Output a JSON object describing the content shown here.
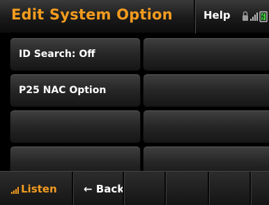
{
  "header": {
    "title": "Edit System Option",
    "help_label": "Help",
    "status_icons": [
      "lock-icon",
      "signal-icon",
      "battery-icon"
    ],
    "accent_color": "#f39c1f"
  },
  "options": [
    {
      "label": "ID Search: Off"
    },
    {
      "label": ""
    },
    {
      "label": "P25 NAC Option"
    },
    {
      "label": ""
    },
    {
      "label": ""
    },
    {
      "label": ""
    },
    {
      "label": ""
    },
    {
      "label": ""
    }
  ],
  "footer": {
    "listen_label": "Listen",
    "back_label": "← Back"
  }
}
